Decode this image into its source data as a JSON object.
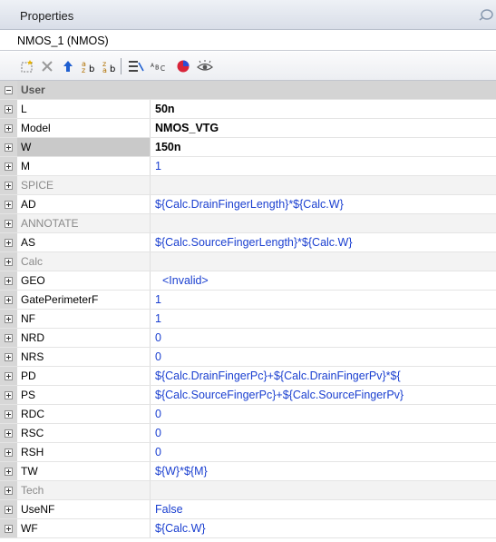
{
  "panel": {
    "title": "Properties",
    "component": "NMOS_1 (NMOS)"
  },
  "toolbar": {
    "buttons": [
      {
        "name": "new-property-icon",
        "glyph": "⬚"
      },
      {
        "name": "delete-icon",
        "glyph": "✕"
      },
      {
        "name": "move-up-icon",
        "glyph": "⬆"
      },
      {
        "name": "sort-ascending-icon",
        "glyph": "ªb"
      },
      {
        "name": "sort-descending-icon",
        "glyph": "ªb"
      },
      {
        "name": "categorize-icon",
        "glyph": "⊟"
      },
      {
        "name": "rename-icon",
        "glyph": "ᴬʙᴄ"
      },
      {
        "name": "color-icon",
        "glyph": "●"
      },
      {
        "name": "visibility-icon",
        "glyph": "👁"
      }
    ]
  },
  "rows": [
    {
      "name": "User",
      "value": "",
      "kind": "header"
    },
    {
      "name": "L",
      "value": "50n",
      "kind": "prop",
      "style": "black"
    },
    {
      "name": "Model",
      "value": "NMOS_VTG",
      "kind": "prop",
      "style": "black"
    },
    {
      "name": "W",
      "value": "150n",
      "kind": "prop",
      "style": "black",
      "selected": true
    },
    {
      "name": "M",
      "value": "1",
      "kind": "prop",
      "style": "blue"
    },
    {
      "name": "SPICE",
      "value": "",
      "kind": "category"
    },
    {
      "name": "AD",
      "value": "${Calc.DrainFingerLength}*${Calc.W}",
      "kind": "prop",
      "style": "blue"
    },
    {
      "name": "ANNOTATE",
      "value": "",
      "kind": "category"
    },
    {
      "name": "AS",
      "value": "${Calc.SourceFingerLength}*${Calc.W}",
      "kind": "prop",
      "style": "blue"
    },
    {
      "name": "Calc",
      "value": "",
      "kind": "category"
    },
    {
      "name": "GEO",
      "value": "<Invalid>",
      "kind": "prop",
      "style": "invalid"
    },
    {
      "name": "GatePerimeterF",
      "value": "1",
      "kind": "prop",
      "style": "blue"
    },
    {
      "name": "NF",
      "value": "1",
      "kind": "prop",
      "style": "blue"
    },
    {
      "name": "NRD",
      "value": "0",
      "kind": "prop",
      "style": "blue"
    },
    {
      "name": "NRS",
      "value": "0",
      "kind": "prop",
      "style": "blue"
    },
    {
      "name": "PD",
      "value": "${Calc.DrainFingerPc}+${Calc.DrainFingerPv}*${",
      "kind": "prop",
      "style": "blue"
    },
    {
      "name": "PS",
      "value": "${Calc.SourceFingerPc}+${Calc.SourceFingerPv}",
      "kind": "prop",
      "style": "blue"
    },
    {
      "name": "RDC",
      "value": "0",
      "kind": "prop",
      "style": "blue"
    },
    {
      "name": "RSC",
      "value": "0",
      "kind": "prop",
      "style": "blue"
    },
    {
      "name": "RSH",
      "value": "0",
      "kind": "prop",
      "style": "blue"
    },
    {
      "name": "TW",
      "value": "${W}*${M}",
      "kind": "prop",
      "style": "blue"
    },
    {
      "name": "Tech",
      "value": "",
      "kind": "category"
    },
    {
      "name": "UseNF",
      "value": "False",
      "kind": "prop",
      "style": "blue"
    },
    {
      "name": "WF",
      "value": "${Calc.W}",
      "kind": "prop",
      "style": "blue"
    }
  ],
  "colors": {
    "value_blue": "#1a3fd0",
    "gutter": "#d7d7d7",
    "header": "#d4d4d4"
  }
}
